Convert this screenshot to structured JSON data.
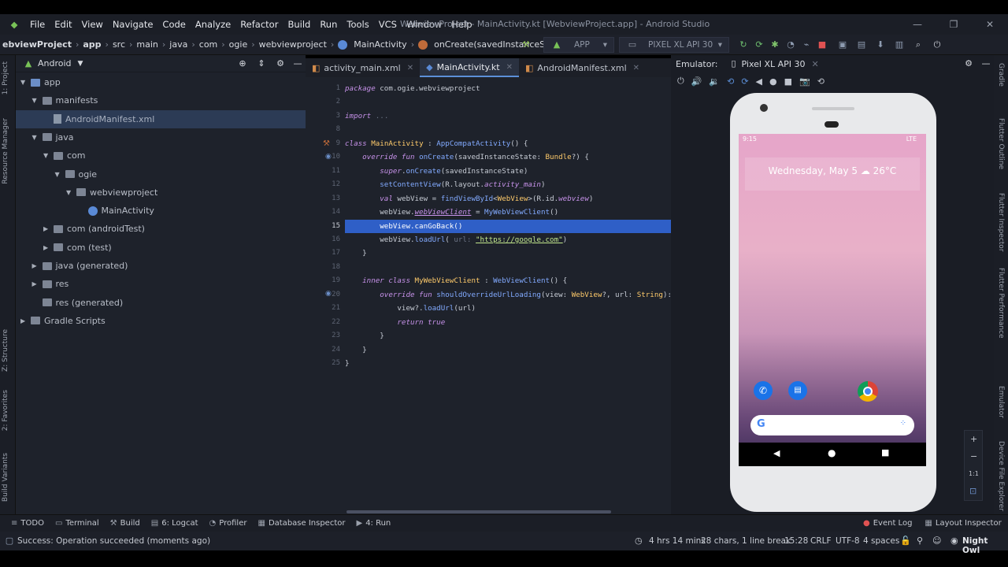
{
  "menu": [
    "File",
    "Edit",
    "View",
    "Navigate",
    "Code",
    "Analyze",
    "Refactor",
    "Build",
    "Run",
    "Tools",
    "VCS",
    "Window",
    "Help"
  ],
  "window_title": "WebviewProject - MainActivity.kt [WebviewProject.app] - Android Studio",
  "breadcrumbs": [
    "ebviewProject",
    "app",
    "src",
    "main",
    "java",
    "com",
    "ogie",
    "webviewproject",
    "MainActivity",
    "onCreate(savedInstanceState: Bundle?)"
  ],
  "run_config": "APP",
  "device": "PIXEL XL API 30",
  "project_panel": {
    "view": "Android",
    "tree": [
      {
        "label": "app",
        "depth": 0,
        "arrow": "▼",
        "icon": "folder-blue"
      },
      {
        "label": "manifests",
        "depth": 1,
        "arrow": "▼",
        "icon": "folder"
      },
      {
        "label": "AndroidManifest.xml",
        "depth": 2,
        "arrow": "",
        "icon": "file",
        "selected": true
      },
      {
        "label": "java",
        "depth": 1,
        "arrow": "▼",
        "icon": "folder"
      },
      {
        "label": "com",
        "depth": 2,
        "arrow": "▼",
        "icon": "folder"
      },
      {
        "label": "ogie",
        "depth": 3,
        "arrow": "▼",
        "icon": "folder"
      },
      {
        "label": "webviewproject",
        "depth": 4,
        "arrow": "▼",
        "icon": "folder"
      },
      {
        "label": "MainActivity",
        "depth": 5,
        "arrow": "",
        "icon": "kt"
      },
      {
        "label": "com (androidTest)",
        "depth": 2,
        "arrow": "▶",
        "icon": "folder"
      },
      {
        "label": "com (test)",
        "depth": 2,
        "arrow": "▶",
        "icon": "folder"
      },
      {
        "label": "java (generated)",
        "depth": 1,
        "arrow": "▶",
        "icon": "folder"
      },
      {
        "label": "res",
        "depth": 1,
        "arrow": "▶",
        "icon": "folder"
      },
      {
        "label": "res (generated)",
        "depth": 1,
        "arrow": "",
        "icon": "folder"
      },
      {
        "label": "Gradle Scripts",
        "depth": 0,
        "arrow": "▶",
        "icon": "gradle"
      }
    ]
  },
  "left_strip": [
    "1: Project",
    "Resource Manager",
    "Z: Structure",
    "2: Favorites",
    "Build Variants"
  ],
  "right_strip": [
    "Gradle",
    "Flutter Outline",
    "Flutter Inspector",
    "Flutter Performance",
    "Emulator",
    "Device File Explorer"
  ],
  "editor_tabs": [
    {
      "label": "activity_main.xml",
      "active": false
    },
    {
      "label": "MainActivity.kt",
      "active": true
    },
    {
      "label": "AndroidManifest.xml",
      "active": false
    }
  ],
  "code_lines": [
    {
      "n": "1",
      "html": "<span class='kw'>package</span> com.ogie.webviewproject"
    },
    {
      "n": "2",
      "html": ""
    },
    {
      "n": "3",
      "html": "<span class='kw'>import</span> <span class='hint'>...</span>"
    },
    {
      "n": "8",
      "html": ""
    },
    {
      "n": "9",
      "html": "<span class='kw'>class</span> <span class='cls'>MainActivity</span> : <span class='fn'>AppCompatActivity</span>() {"
    },
    {
      "n": "10",
      "html": "    <span class='kw'>override fun</span> <span class='fn'>onCreate</span>(savedInstanceState: <span class='cls'>Bundle</span>?) {"
    },
    {
      "n": "11",
      "html": "        <span class='kw'>super</span>.<span class='fn'>onCreate</span>(savedInstanceState)"
    },
    {
      "n": "12",
      "html": "        <span class='fn'>setContentView</span>(R.layout.<span class='prop'>activity_main</span>)"
    },
    {
      "n": "13",
      "html": "        <span class='kw'>val</span> webView = <span class='fn'>findViewById</span>&lt;<span class='cls'>WebView</span>&gt;(R.id.<span class='prop'>webview</span>)"
    },
    {
      "n": "14",
      "html": "        webView.<span class='prop' style='text-decoration:underline'>webViewClient</span> = <span class='fn'>MyWebViewClient</span>()"
    },
    {
      "n": "15",
      "html": "        webView.canGoBack()",
      "highlight": true
    },
    {
      "n": "16",
      "html": "        webView.<span class='fn'>loadUrl</span>( <span class='hint'>url:</span> <span class='str'>\"https://google.com\"</span>)"
    },
    {
      "n": "17",
      "html": "    }"
    },
    {
      "n": "18",
      "html": ""
    },
    {
      "n": "19",
      "html": "    <span class='kw'>inner class</span> <span class='cls'>MyWebViewClient</span> : <span class='fn'>WebViewClient</span>() {"
    },
    {
      "n": "20",
      "html": "        <span class='kw'>override fun</span> <span class='fn'>shouldOverrideUrlLoading</span>(view: <span class='cls'>WebView</span>?, url: <span class='cls'>String</span>): <span class='cls'>Bo</span>"
    },
    {
      "n": "21",
      "html": "            view?.<span class='fn'>loadUrl</span>(url)"
    },
    {
      "n": "22",
      "html": "            <span class='kw'>return true</span>"
    },
    {
      "n": "23",
      "html": "        }"
    },
    {
      "n": "24",
      "html": "    }"
    },
    {
      "n": "25",
      "html": "}"
    }
  ],
  "emulator": {
    "label": "Emulator:",
    "device_tab": "Pixel XL API 30",
    "status_time": "9:15",
    "status_net": "LTE",
    "date_widget": "Wednesday, May 5 ☁ 26°C",
    "zoom_label": "1:1"
  },
  "tool_windows": [
    "TODO",
    "Terminal",
    "Build",
    "6: Logcat",
    "Profiler",
    "Database Inspector",
    "4: Run"
  ],
  "tool_windows_right": [
    "Event Log",
    "Layout Inspector"
  ],
  "status": {
    "message": "Success: Operation succeeded (moments ago)",
    "time": "4 hrs 14 mins",
    "selection": "28 chars, 1 line break",
    "position": "15:28",
    "line_sep": "CRLF",
    "encoding": "UTF-8",
    "indent": "4 spaces",
    "theme": "Night Owl"
  }
}
